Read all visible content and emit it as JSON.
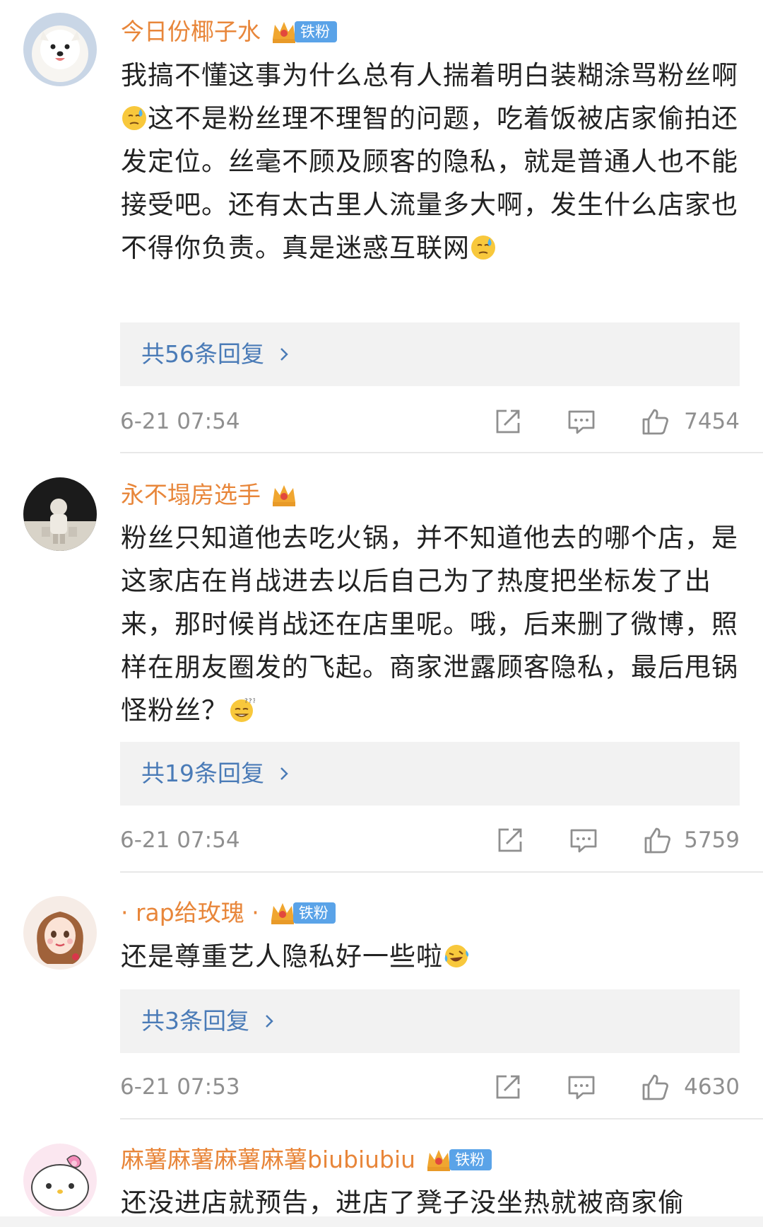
{
  "colors": {
    "username": "#e8863a",
    "reply_link": "#4a7bb7",
    "meta": "#8f8f8f",
    "fan_tag": "#5aa3e8"
  },
  "comments": [
    {
      "username": "今日份椰子水",
      "badge": "铁粉",
      "text_parts": [
        "我搞不懂这事为什么总有人揣着明白装糊涂骂粉丝啊",
        "这不是粉丝理不理智的问题，吃着饭被店家偷拍还发定位。丝毫不顾及顾客的隐私，就是普通人也不能接受吧。还有太古里人流量多大啊，发生什么店家也不得你负责。真是迷惑互联网"
      ],
      "emojis": [
        "sweat-emoji",
        "sweat-emoji"
      ],
      "replies": "共56条回复",
      "time": "6-21 07:54",
      "likes": "7454"
    },
    {
      "username": "永不塌房选手",
      "badge": "",
      "text_parts": [
        "粉丝只知道他去吃火锅，并不知道他去的哪个店，是这家店在肖战进去以后自己为了热度把坐标发了出来，那时候肖战还在店里呢。哦，后来删了微博，照样在朋友圈发的飞起。商家泄露顾客隐私，最后甩锅怪粉丝？"
      ],
      "emojis": [
        "thinking-emoji"
      ],
      "replies": "共19条回复",
      "time": "6-21 07:54",
      "likes": "5759"
    },
    {
      "username": "· rap给玫瑰 ·",
      "badge": "铁粉",
      "text_parts": [
        "还是尊重艺人隐私好一些啦"
      ],
      "emojis": [
        "laugh-cry-emoji"
      ],
      "replies": "共3条回复",
      "time": "6-21 07:53",
      "likes": "4630"
    },
    {
      "username": "麻薯麻薯麻薯麻薯biubiubiu",
      "badge": "铁粉",
      "text_parts": [
        "还没进店就预告，进店了凳子没坐热就被商家偷"
      ],
      "emojis": [],
      "replies": "",
      "time": "",
      "likes": ""
    }
  ],
  "icons": {
    "share": "share-icon",
    "comment": "comment-icon",
    "like": "thumbs-up-icon",
    "crown": "crown-icon",
    "chevron": "chevron-right-icon"
  }
}
